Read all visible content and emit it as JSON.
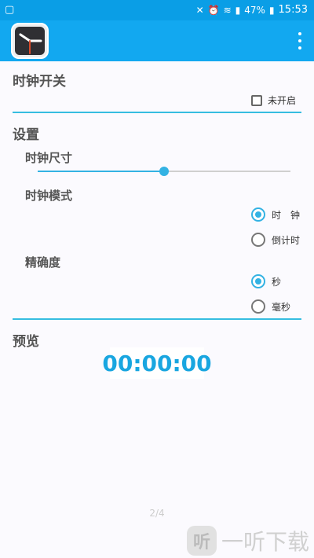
{
  "status_bar": {
    "signal": "47%",
    "time": "15:53"
  },
  "toolbar": {
    "menu_icon": "overflow-menu"
  },
  "clock_switch": {
    "title": "时钟开关",
    "checkbox_label": "未开启",
    "checked": false
  },
  "settings": {
    "title": "设置",
    "clock_size": {
      "title": "时钟尺寸",
      "value": 0.5
    },
    "clock_mode": {
      "title": "时钟模式",
      "options": [
        {
          "label": "时　钟",
          "checked": true
        },
        {
          "label": "倒计时",
          "checked": false
        }
      ]
    },
    "precision": {
      "title": "精确度",
      "options": [
        {
          "label": "秒",
          "checked": true
        },
        {
          "label": "毫秒",
          "checked": false
        }
      ]
    }
  },
  "preview": {
    "title": "预览",
    "time": "00:00:00"
  },
  "pager": {
    "label": "2/4"
  },
  "watermark": {
    "text": "一听下载",
    "icon_glyph": "听"
  },
  "colors": {
    "accent": "#33b2e3",
    "appbar": "#12a8f0",
    "statusbar": "#0a9ee6"
  }
}
